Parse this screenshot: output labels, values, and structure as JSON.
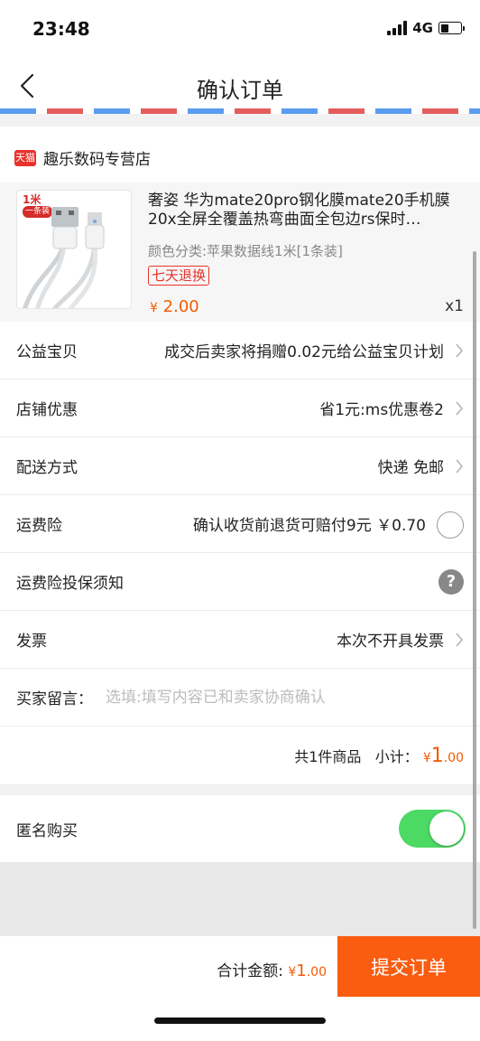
{
  "status_bar": {
    "time": "23:48",
    "network": "4G",
    "battery_level": 0.4
  },
  "nav": {
    "title": "确认订单"
  },
  "shop": {
    "badge": "天猫",
    "name": "趣乐数码专营店",
    "product": {
      "image_tag": "1米",
      "image_tag_sub": "一条装",
      "title": "奢姿 华为mate20pro钢化膜mate20手机膜20x全屏全覆盖热弯曲面全包边rs保时…",
      "spec": "颜色分类:苹果数据线1米[1条装]",
      "return_badge": "七天退换",
      "price_symbol": "¥",
      "price": "2.00",
      "quantity": "x1"
    }
  },
  "rows": {
    "charity": {
      "label": "公益宝贝",
      "value": "成交后卖家将捐赠0.02元给公益宝贝计划"
    },
    "shop_discount": {
      "label": "店铺优惠",
      "value": "省1元:ms优惠卷2"
    },
    "delivery": {
      "label": "配送方式",
      "value": "快递 免邮"
    },
    "shipping_insurance": {
      "label": "运费险",
      "value": "确认收货前退货可赔付9元 ￥0.70"
    },
    "insurance_notice": {
      "label": "运费险投保须知",
      "help": "?"
    },
    "invoice": {
      "label": "发票",
      "value": "本次不开具发票"
    },
    "message": {
      "label": "买家留言：",
      "placeholder": "选填:填写内容已和卖家协商确认"
    },
    "subtotal": {
      "count_text": "共1件商品",
      "label": "小计：",
      "symbol": "¥",
      "integer": "1",
      "decimal": ".00"
    }
  },
  "anonymous": {
    "label": "匿名购买",
    "enabled": true
  },
  "footer": {
    "total_label": "合计金额:",
    "symbol": "¥",
    "integer": "1",
    "decimal": ".00",
    "submit_label": "提交订单"
  },
  "colors": {
    "accent": "#fa5c10",
    "price": "#f25c05",
    "toggle_on": "#4cd964",
    "tmall": "#e8322b"
  }
}
